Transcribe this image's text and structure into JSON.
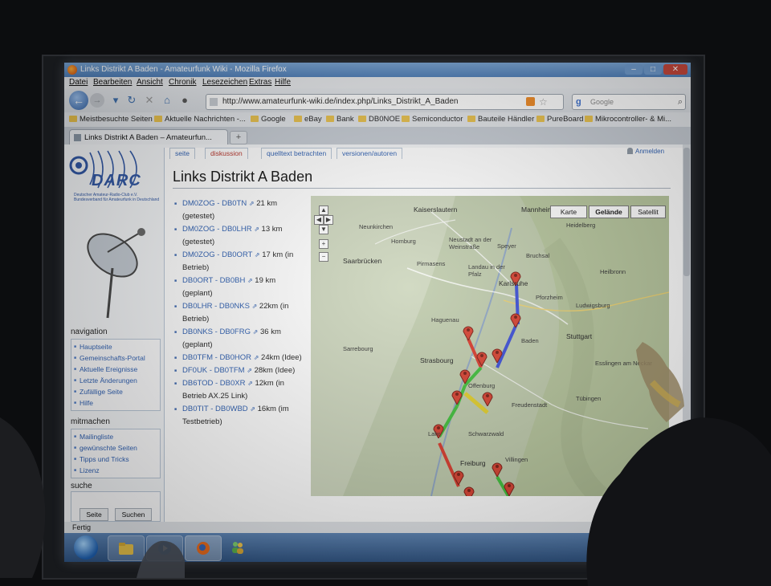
{
  "window": {
    "title": "Links Distrikt A Baden - Amateurfunk Wiki - Mozilla Firefox"
  },
  "menu": [
    "Datei",
    "Bearbeiten",
    "Ansicht",
    "Chronik",
    "Lesezeichen",
    "Extras",
    "Hilfe"
  ],
  "address_bar": {
    "url": "http://www.amateurfunk-wiki.de/index.php/Links_Distrikt_A_Baden"
  },
  "search_bar": {
    "placeholder": "Google"
  },
  "bookmarks": [
    "Meistbesuchte Seiten",
    "Aktuelle Nachrichten -...",
    "Google",
    "eBay",
    "Bank",
    "DB0NOE",
    "Semiconductor",
    "Bauteile Händler",
    "PureBoard",
    "Mikrocontroller- & Mi..."
  ],
  "tab": {
    "label": "Links Distrikt A Baden – Amateurfun..."
  },
  "wiki_tabs": [
    "seite",
    "diskussion",
    "quelltext betrachten",
    "versionen/autoren"
  ],
  "personal": {
    "login": "Anmelden"
  },
  "logo": {
    "text": "DARC",
    "subtext": "Deutscher Amateur-Radio-Club e.V. Bundesverband für Amateurfunk in Deutschland"
  },
  "page_title": "Links Distrikt A Baden",
  "links": [
    {
      "link": "DM0ZOG - DB0TN",
      "ext": "⇗",
      "note": " 21 km (getestet)"
    },
    {
      "link": "DM0ZOG - DB0LHR",
      "ext": "⇗",
      "note": " 13 km (getestet)"
    },
    {
      "link": "DM0ZOG - DB0ORT",
      "ext": "⇗",
      "note": " 17 km (in Betrieb)"
    },
    {
      "link": "DB0ORT - DB0BH",
      "ext": "⇗",
      "note": " 19 km (geplant)"
    },
    {
      "link": "DB0LHR - DB0NKS",
      "ext": "⇗",
      "note": " 22km (in Betrieb)"
    },
    {
      "link": "DB0NKS - DB0FRG",
      "ext": "⇗",
      "note": " 36 km (geplant)"
    },
    {
      "link": "DB0TFM - DB0HOR",
      "ext": "⇗",
      "note": " 24km (Idee)"
    },
    {
      "link": "DF0UK - DB0TFM",
      "ext": "⇗",
      "note": " 28km (Idee)"
    },
    {
      "link": "DB6TOD - DB0XR",
      "ext": "⇗",
      "note": " 12km (in Betrieb AX.25 Link)"
    },
    {
      "link": "DB0TIT - DB0WBD",
      "ext": "⇗",
      "note": " 16km (im Testbetrieb)"
    }
  ],
  "sidebar": {
    "navigation_heading": "navigation",
    "navigation": [
      "Hauptseite",
      "Gemeinschafts-Portal",
      "Aktuelle Ereignisse",
      "Letzte Änderungen",
      "Zufällige Seite",
      "Hilfe"
    ],
    "mitmachen_heading": "mitmachen",
    "mitmachen": [
      "Mailingliste",
      "gewünschte Seiten",
      "Tipps und Tricks",
      "Lizenz"
    ],
    "search_heading": "suche",
    "search_buttons": [
      "Seite",
      "Suchen"
    ]
  },
  "map": {
    "types": [
      "Karte",
      "Gelände",
      "Satellit"
    ],
    "places": [
      "Kaiserslautern",
      "Mannheim",
      "Neunkirchen",
      "Homburg",
      "Neustadt an der Weinstraße",
      "Speyer",
      "Heidelberg",
      "Saarbrücken",
      "Pirmasens",
      "Landau in der Pfalz",
      "Bruchsal",
      "Karlsruhe",
      "Heilbronn",
      "Pforzheim",
      "Ludwigsburg",
      "Haguenau",
      "Baden",
      "Stuttgart",
      "Strasbourg",
      "Esslingen am Neckar",
      "Sarrebourg",
      "Freudenstadt",
      "Tübingen",
      "Offenburg",
      "Lahr",
      "Schwarzwald",
      "Freiburg",
      "Villingen"
    ],
    "colors": {
      "red": "#d93a2b",
      "blue": "#3b4fd8",
      "green": "#3fbf3a",
      "yellow": "#e2cf2a",
      "marker": "#d8402f"
    }
  },
  "status": {
    "text": "Fertig"
  }
}
